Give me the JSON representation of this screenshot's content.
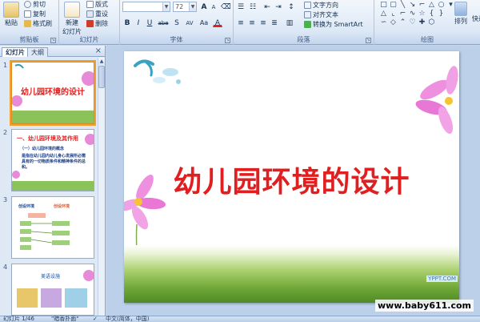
{
  "ribbon": {
    "clipboard": {
      "label": "剪贴板",
      "paste": "粘贴",
      "cut": "剪切",
      "copy": "复制",
      "format_painter": "格式刷"
    },
    "slides": {
      "label": "幻灯片",
      "new_slide_line1": "新建",
      "new_slide_line2": "幻灯片",
      "layout": "版式",
      "reset": "重设",
      "delete": "删除"
    },
    "font": {
      "label": "字体",
      "font_size": "72",
      "bold": "B",
      "italic": "I",
      "underline": "U",
      "strike": "abe",
      "shadow": "S",
      "spacing": "AV",
      "case": "Aa",
      "color": "A",
      "grow": "A",
      "shrink": "A"
    },
    "paragraph": {
      "label": "段落",
      "text_direction": "文字方向",
      "align_text": "对齐文本",
      "smartart": "转换为 SmartArt"
    },
    "drawing": {
      "label": "绘图",
      "arrange": "排列",
      "quick_styles": "快速"
    }
  },
  "pane": {
    "tab_slides": "幻灯片",
    "tab_outline": "大纲",
    "close": "×",
    "thumbnails": [
      {
        "num": "1",
        "title": "幼儿园环境的设计"
      },
      {
        "num": "2",
        "title": "一、幼儿园环境及其作用",
        "heading": "（一）幼儿园环境的概念",
        "body": "是指在幼儿园内幼儿身心发展所必需具有的一切物质条件和精神条件的总和。"
      },
      {
        "num": "3",
        "title": "创设环境",
        "subtitle": "创设环境"
      },
      {
        "num": "4",
        "title": "美语设施"
      }
    ]
  },
  "slide": {
    "title": "幼儿园环境的设计",
    "watermark": "www.baby611.com",
    "stamp": "YPPT.COM"
  },
  "status": {
    "slide_count": "幻灯片 1/46",
    "theme": "\"暗香扑面\"",
    "language": "中文(简体，中国)"
  },
  "colors": {
    "title_red": "#e02020",
    "selection_orange": "#f0a030"
  }
}
